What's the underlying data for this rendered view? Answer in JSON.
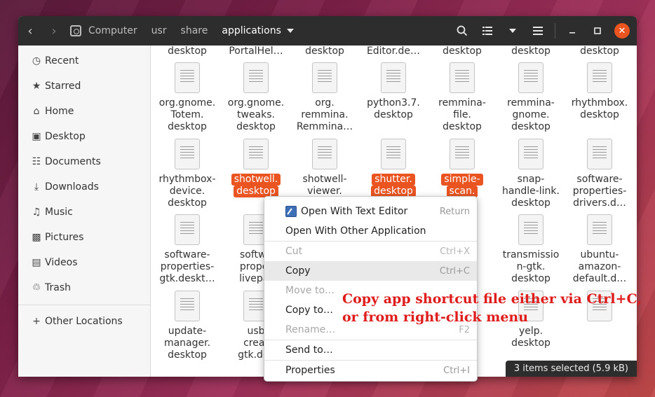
{
  "header": {
    "crumbs": [
      "Computer",
      "usr",
      "share",
      "applications"
    ],
    "active_crumb": "applications"
  },
  "sidebar": {
    "items": [
      {
        "label": "Recent",
        "icon": "clock-icon"
      },
      {
        "label": "Starred",
        "icon": "star-icon"
      },
      {
        "label": "Home",
        "icon": "home-icon"
      },
      {
        "label": "Desktop",
        "icon": "desktop-icon"
      },
      {
        "label": "Documents",
        "icon": "documents-icon"
      },
      {
        "label": "Downloads",
        "icon": "download-icon"
      },
      {
        "label": "Music",
        "icon": "music-icon"
      },
      {
        "label": "Pictures",
        "icon": "pictures-icon"
      },
      {
        "label": "Videos",
        "icon": "videos-icon"
      },
      {
        "label": "Trash",
        "icon": "trash-icon"
      }
    ],
    "other_locations": "Other Locations"
  },
  "top_row": [
    "desktop",
    "PortalHel…",
    "desktop",
    "Editor.de…",
    "desktop",
    "desktop",
    "desktop"
  ],
  "files": {
    "row1": [
      {
        "name": "org.gnome.\nTotem.\ndesktop",
        "selected": false
      },
      {
        "name": "org.gnome.\ntweaks.\ndesktop",
        "selected": false
      },
      {
        "name": "org.\nremmina.\nRemmina…",
        "selected": false
      },
      {
        "name": "python3.7.\ndesktop",
        "selected": false
      },
      {
        "name": "remmina-\nfile.\ndesktop",
        "selected": false
      },
      {
        "name": "remmina-\ngnome.\ndesktop",
        "selected": false
      },
      {
        "name": "rhythmbox.\ndesktop",
        "selected": false
      }
    ],
    "row2": [
      {
        "name": "rhythmbox-\ndevice.\ndesktop",
        "selected": false
      },
      {
        "name": "shotwell.\ndesktop",
        "selected": true
      },
      {
        "name": "shotwell-\nviewer.",
        "selected": false
      },
      {
        "name": "shutter.\ndesktop",
        "selected": true
      },
      {
        "name": "simple-\nscan.\nop",
        "selected": true
      },
      {
        "name": "snap-\nhandle-link.\ndesktop",
        "selected": false
      },
      {
        "name": "software-\nproperties-\ndrivers.d…",
        "selected": false
      }
    ],
    "row3": [
      {
        "name": "software-\nproperties-\ngtk.deskt…",
        "selected": false
      },
      {
        "name": "softwa\nproper\nlivepat",
        "selected": false
      },
      {
        "name": "",
        "selected": false
      },
      {
        "name": "",
        "selected": false
      },
      {
        "name": "oir\nop",
        "selected": false
      },
      {
        "name": "transmissio\nn-gtk.\ndesktop",
        "selected": false
      },
      {
        "name": "ubuntu-\namazon-\ndefault.d…",
        "selected": false
      }
    ],
    "row4": [
      {
        "name": "update-\nmanager.\ndesktop",
        "selected": false
      },
      {
        "name": "usb\ncreat\ngtk.des",
        "selected": false
      },
      {
        "name": "",
        "selected": false
      },
      {
        "name": "",
        "selected": false
      },
      {
        "name": "o-",
        "selected": false
      },
      {
        "name": "yelp.\ndesktop",
        "selected": false
      },
      {
        "name": "",
        "selected": false
      }
    ]
  },
  "context_menu": {
    "items": [
      {
        "label": "Open With Text Editor",
        "accel": "Return",
        "disabled": false,
        "hover": false,
        "icon": "text-editor-icon"
      },
      {
        "label": "Open With Other Application",
        "accel": "",
        "disabled": false,
        "hover": false
      },
      {
        "label": "Cut",
        "accel": "Ctrl+X",
        "disabled": true,
        "hover": false
      },
      {
        "label": "Copy",
        "accel": "Ctrl+C",
        "disabled": false,
        "hover": true
      },
      {
        "label": "Move to…",
        "accel": "",
        "disabled": true,
        "hover": false
      },
      {
        "label": "Copy to…",
        "accel": "",
        "disabled": false,
        "hover": false
      },
      {
        "label": "Rename…",
        "accel": "F2",
        "disabled": true,
        "hover": false
      },
      {
        "label": "Send to…",
        "accel": "",
        "disabled": false,
        "hover": false
      },
      {
        "label": "Properties",
        "accel": "Ctrl+I",
        "disabled": false,
        "hover": false
      }
    ]
  },
  "status": "3 items selected  (5.9 kB)",
  "annotation": {
    "line1": "Copy app shortcut file either via Ctrl+C,",
    "line2": "or from right-click menu"
  },
  "colors": {
    "accent": "#e95420",
    "headerbar": "#2d2d2d",
    "annotation": "#e01b1b"
  }
}
